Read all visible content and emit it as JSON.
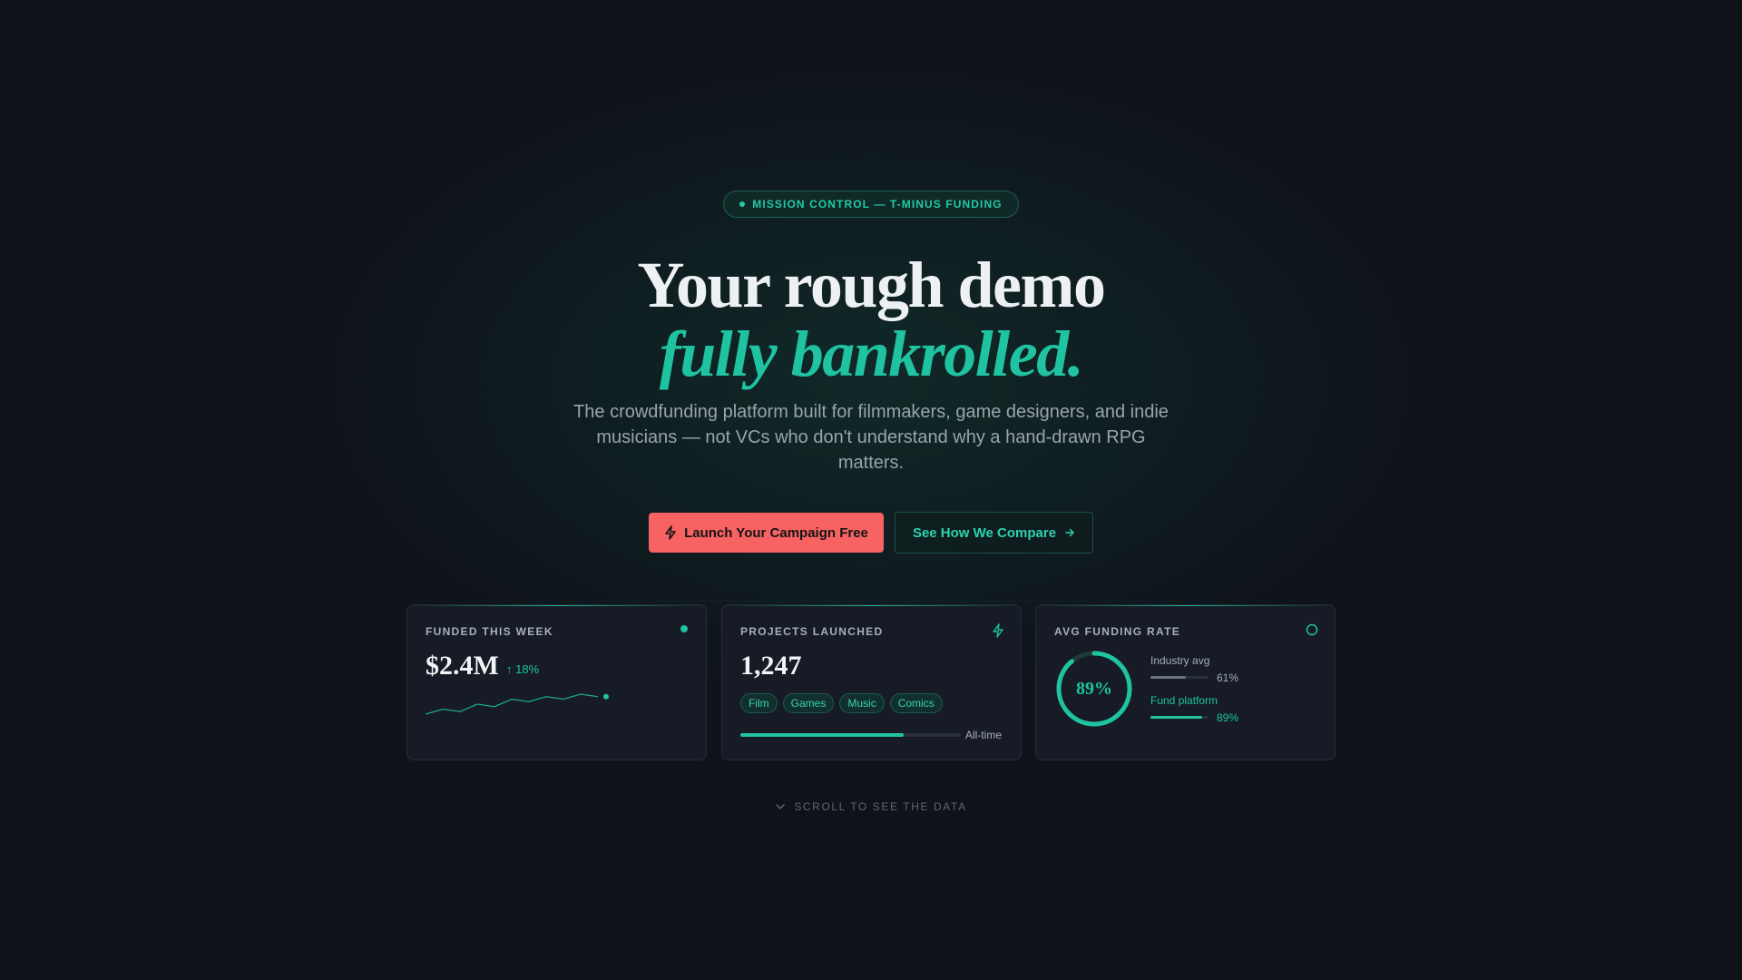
{
  "badge": {
    "label": "MISSION CONTROL — T-MINUS FUNDING"
  },
  "hero": {
    "headline": "Your rough demo",
    "headline_accent": "fully bankrolled.",
    "subtitle": "The crowdfunding platform built for filmmakers, game designers, and indie musicians — not VCs who don't understand why a hand-drawn RPG matters."
  },
  "cta": {
    "primary_label": "Launch Your Campaign Free",
    "secondary_label": "See How We Compare"
  },
  "cards": {
    "funded": {
      "title": "FUNDED THIS WEEK",
      "value": "$2.4M",
      "delta": "↑ 18%",
      "sparkline": [
        2,
        4,
        3,
        6,
        5,
        8,
        7,
        9,
        8,
        10,
        9
      ]
    },
    "projects": {
      "title": "PROJECTS LAUNCHED",
      "value": "1,247",
      "tags": [
        "Film",
        "Games",
        "Music",
        "Comics"
      ],
      "progress": 0.74,
      "progress_label": "All-time"
    },
    "rate": {
      "title": "AVG FUNDING RATE",
      "value": "89%",
      "ring_fraction": 0.89,
      "industry_label": "Industry avg",
      "industry_value": "61%",
      "industry_fraction": 0.61,
      "platform_label": "Fund platform",
      "platform_value": "89%",
      "platform_fraction": 0.89
    }
  },
  "scroll_hint": "SCROLL TO SEE THE DATA",
  "colors": {
    "accent": "#1fc3a1",
    "cta": "#f76262",
    "background": "#0e1219"
  },
  "icons": [
    "bolt-icon",
    "arrow-right-icon",
    "chevron-down-icon",
    "status-dot-icon",
    "circle-outline-icon"
  ]
}
